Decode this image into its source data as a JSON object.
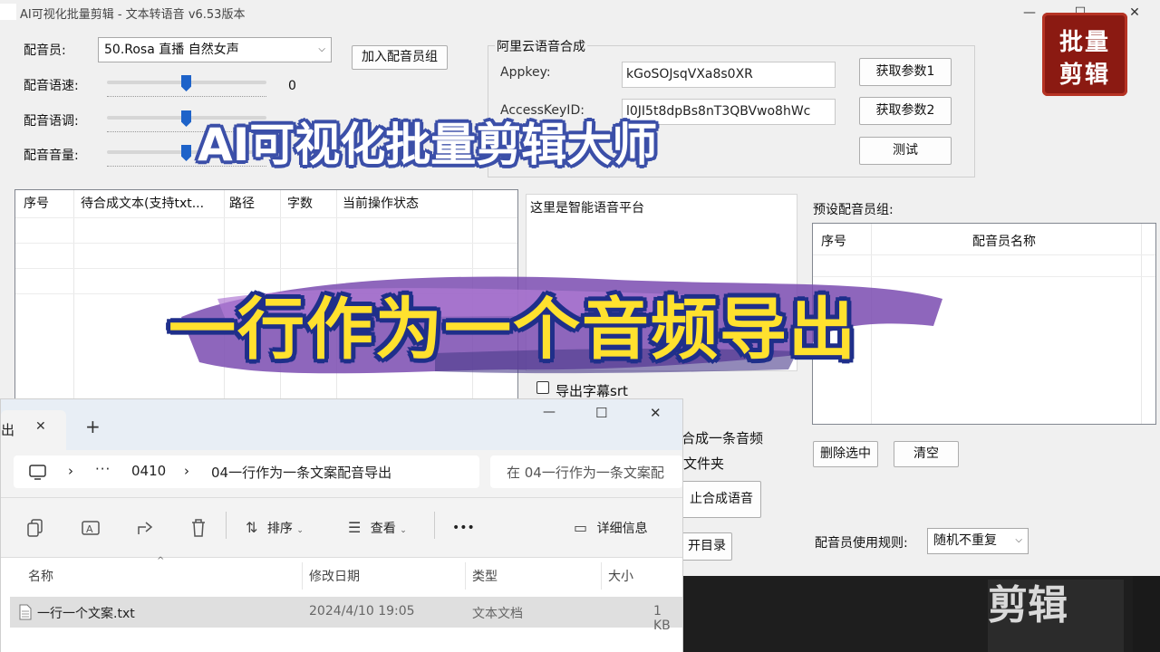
{
  "window": {
    "title": "AI可视化批量剪辑 -  文本转语音  v6.53版本",
    "minimize": "—",
    "maximize": "☐",
    "close": "✕"
  },
  "voice": {
    "label_voice": "配音员:",
    "voice_value": "50.Rosa 直播 自然女声",
    "add_group_button": "加入配音员组",
    "label_speed": "配音语速:",
    "speed_value": "0",
    "label_pitch": "配音语调:",
    "label_volume": "配音音量:"
  },
  "aliyun": {
    "group_title": "阿里云语音合成",
    "appkey_label": "Appkey:",
    "appkey_value": "kGoSOJsqVXa8s0XR",
    "accesskey_label": "AccessKeyID:",
    "accesskey_value": "l0JI5t8dpBs8nT3QBVwo8hWc",
    "get_param1": "获取参数1",
    "get_param2": "获取参数2",
    "test_button": "测试"
  },
  "task_table": {
    "columns": [
      "序号",
      "待合成文本(支持txt...",
      "路径",
      "字数",
      "当前操作状态"
    ]
  },
  "platform_text": "这里是智能语音平台",
  "options": {
    "export_srt": "导出字幕srt",
    "merge_one": "合成一条音频",
    "folder": "文件夹",
    "stop_synth": "止合成语音",
    "open_dir": "开目录"
  },
  "preset_group": {
    "label": "预设配音员组:",
    "columns": [
      "序号",
      "配音员名称"
    ],
    "delete_selected": "删除选中",
    "clear": "清空",
    "rule_label": "配音员使用规则:",
    "rule_value": "随机不重复"
  },
  "overlay": {
    "title": "AI可视化批量剪辑大师",
    "subtitle": "一行作为一个音频导出",
    "logo_line1": "批量",
    "logo_line2": "剪辑",
    "bg_text": "剪辑"
  },
  "explorer": {
    "tab_label": "出",
    "tab_close": "✕",
    "new_tab": "+",
    "breadcrumb": [
      "0410",
      "04一行作为一条文案配音导出"
    ],
    "search_placeholder": "在 04一行作为一条文案配",
    "toolbar": {
      "sort": "排序",
      "view": "查看",
      "more": "•••",
      "details": "详细信息"
    },
    "columns": [
      "名称",
      "修改日期",
      "类型",
      "大小"
    ],
    "files": [
      {
        "name": "一行一个文案.txt",
        "date": "2024/4/10 19:05",
        "type": "文本文档",
        "size": "1 KB"
      }
    ]
  },
  "colors": {
    "accent": "#1e63c9",
    "banner_yellow": "#ffe12e",
    "banner_outline": "#1f2f8a",
    "logo_red": "#8b1a12"
  }
}
